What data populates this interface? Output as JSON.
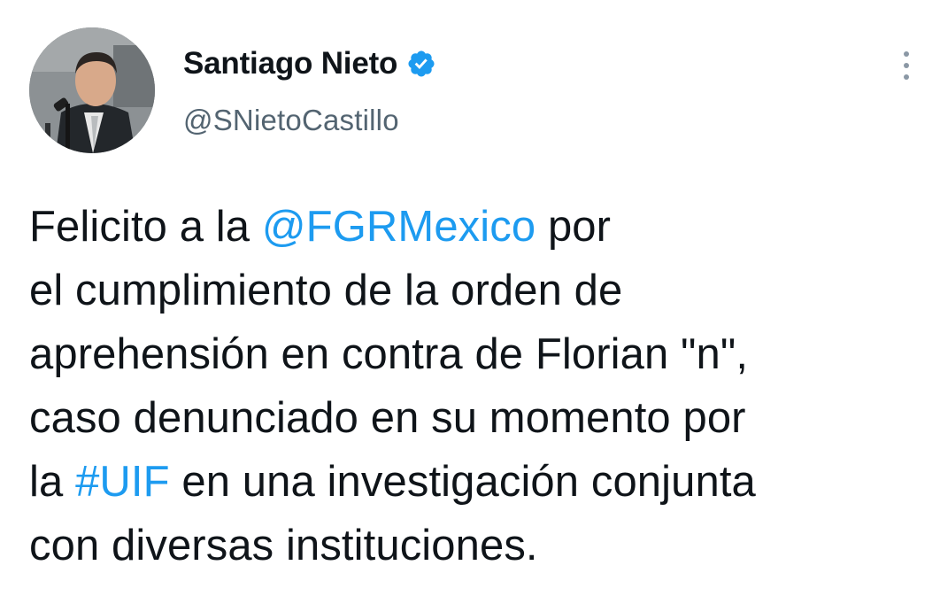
{
  "author": {
    "display_name": "Santiago Nieto",
    "handle": "@SNietoCastillo",
    "verified": true,
    "avatar_icon": "profile-photo-man-at-microphone"
  },
  "icons": {
    "verified": "verified-badge-icon",
    "more": "more-vertical-icon"
  },
  "colors": {
    "link": "#1d9bf0",
    "text": "#0f1419",
    "secondary": "#536471"
  },
  "tweet": {
    "lines": [
      [
        {
          "text": "Felicito a la ",
          "type": "text"
        },
        {
          "text": "@FGRMexico",
          "type": "mention"
        },
        {
          "text": " por",
          "type": "text"
        }
      ],
      [
        {
          "text": "el cumplimiento de la orden de",
          "type": "text"
        }
      ],
      [
        {
          "text": "aprehensión en contra de Florian \"n\",",
          "type": "text"
        }
      ],
      [
        {
          "text": "caso denunciado en su momento por",
          "type": "text"
        }
      ],
      [
        {
          "text": "la ",
          "type": "text"
        },
        {
          "text": "#UIF",
          "type": "hashtag"
        },
        {
          "text": " en una investigación conjunta",
          "type": "text"
        }
      ],
      [
        {
          "text": "con diversas instituciones.",
          "type": "text"
        }
      ]
    ]
  }
}
